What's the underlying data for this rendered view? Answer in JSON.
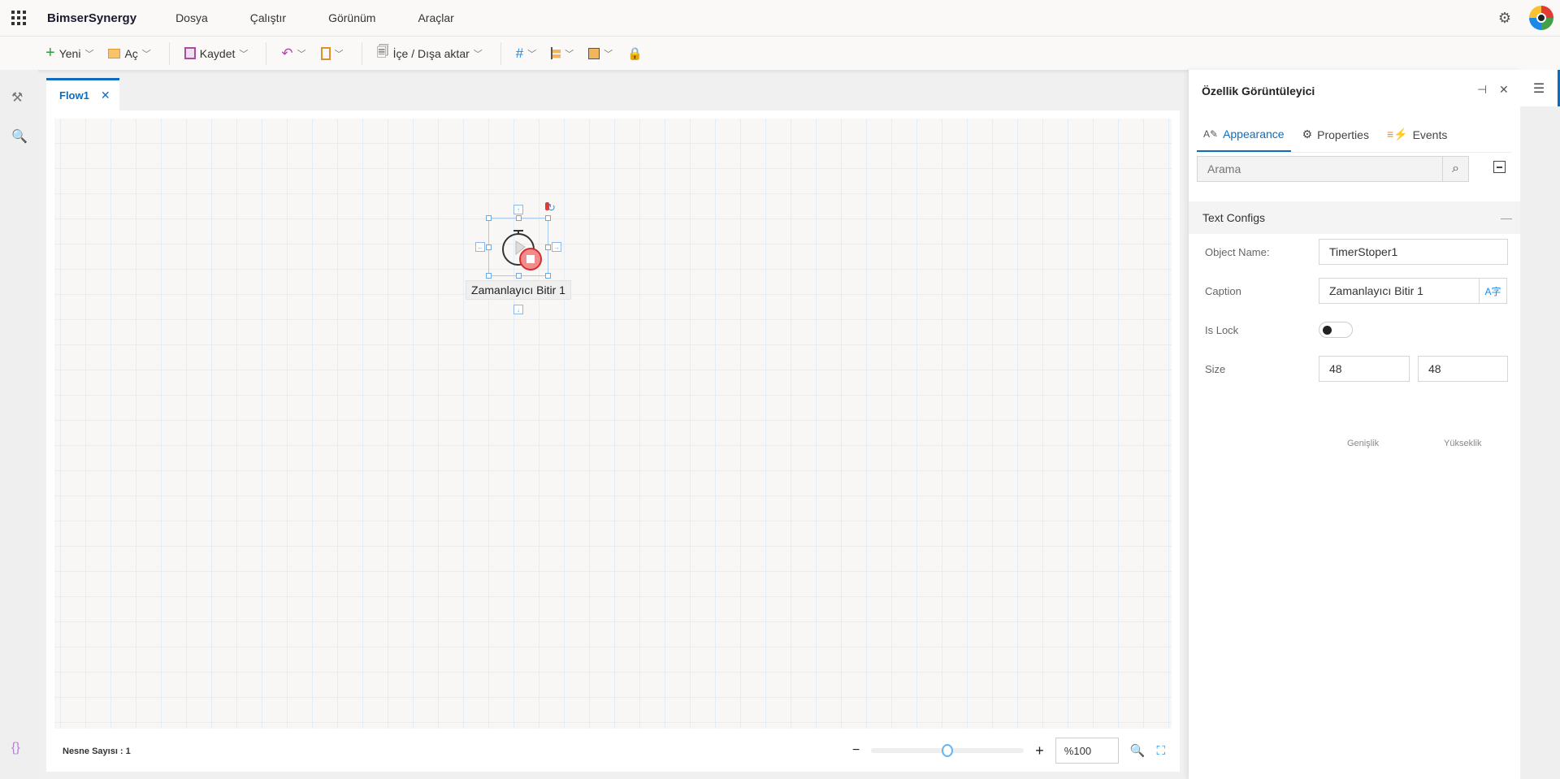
{
  "app": {
    "title": "BimserSynergy",
    "menus": [
      "Dosya",
      "Çalıştır",
      "Görünüm",
      "Araçlar"
    ]
  },
  "toolbar": {
    "new": "Yeni",
    "open": "Aç",
    "save": "Kaydet",
    "import_export": "İçe / Dışa aktar"
  },
  "tabs": [
    {
      "label": "Flow1",
      "active": true
    }
  ],
  "canvas": {
    "node": {
      "caption": "Zamanlayıcı Bitir 1",
      "icon": "timer-stop-icon"
    }
  },
  "status": {
    "object_count": "Nesne Sayısı : 1",
    "zoom_value": "%100",
    "zoom_slider_percent": 50
  },
  "panel": {
    "title": "Özellik Görüntüleyici",
    "tabs": [
      "Appearance",
      "Properties",
      "Events"
    ],
    "active_tab": "Appearance",
    "search_placeholder": "Arama",
    "section": "Text Configs",
    "fields": {
      "object_name_label": "Object Name:",
      "object_name": "TimerStoper1",
      "caption_label": "Caption",
      "caption": "Zamanlayıcı Bitir 1",
      "is_lock_label": "Is Lock",
      "is_lock": false,
      "size_label": "Size",
      "width": "48",
      "height": "48",
      "width_label": "Genişlik",
      "height_label": "Yükseklik"
    }
  },
  "colors": {
    "accent": "#0f6cbd",
    "stop_red": "#e53935"
  }
}
